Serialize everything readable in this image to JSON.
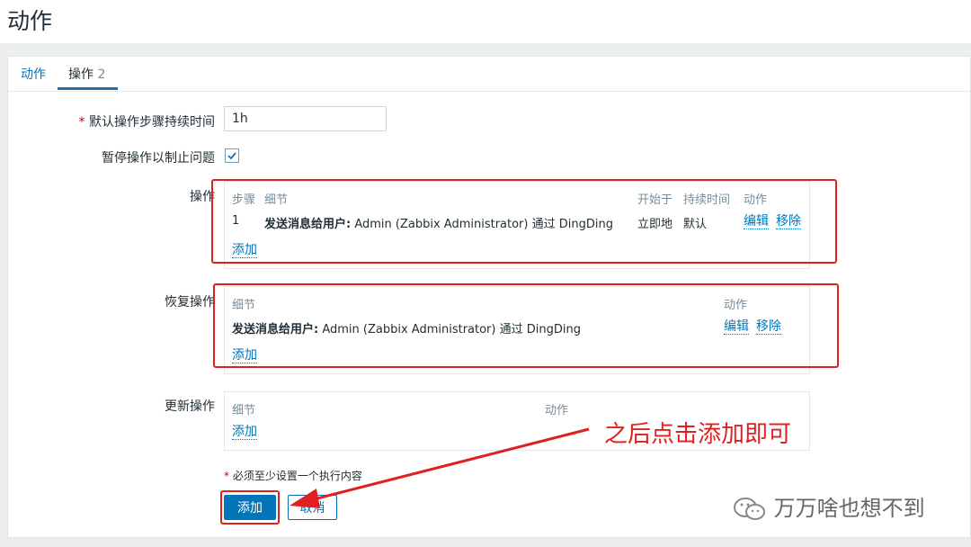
{
  "page_title": "动作",
  "tabs": [
    {
      "label": "动作"
    },
    {
      "label": "操作",
      "count": "2"
    }
  ],
  "form": {
    "duration_required_mark": "*",
    "duration_label": "默认操作步骤持续时间",
    "duration_value": "1h",
    "pause_label": "暂停操作以制止问题",
    "pause_checked": true
  },
  "operations": {
    "label": "操作",
    "headers": {
      "steps": "步骤",
      "details": "细节",
      "start_in": "开始于",
      "duration": "持续时间",
      "action": "动作"
    },
    "rows": [
      {
        "step": "1",
        "detail_bold": "发送消息给用户:",
        "detail_rest": " Admin (Zabbix Administrator) 通过 DingDing",
        "start_in": "立即地",
        "duration": "默认",
        "edit": "编辑",
        "remove": "移除"
      }
    ],
    "add": "添加"
  },
  "recovery": {
    "label": "恢复操作",
    "headers": {
      "details": "细节",
      "action": "动作"
    },
    "rows": [
      {
        "detail_bold": "发送消息给用户:",
        "detail_rest": " Admin (Zabbix Administrator) 通过 DingDing",
        "edit": "编辑",
        "remove": "移除"
      }
    ],
    "add": "添加"
  },
  "update": {
    "label": "更新操作",
    "headers": {
      "details": "细节",
      "action": "动作"
    },
    "add": "添加"
  },
  "note": "必须至少设置一个执行内容",
  "note_mark": "*",
  "buttons": {
    "add": "添加",
    "cancel": "取消"
  },
  "annotation": "之后点击添加即可",
  "watermark": "万万啥也想不到",
  "colors": {
    "accent": "#0275b8",
    "highlight": "#e02020"
  }
}
